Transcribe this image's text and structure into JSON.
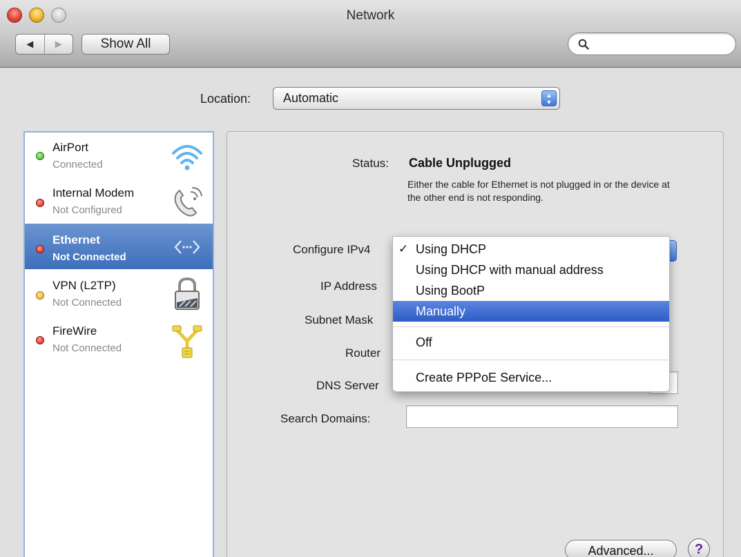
{
  "window": {
    "title": "Network"
  },
  "toolbar": {
    "back_glyph": "◀",
    "forward_glyph": "▶",
    "show_all_label": "Show All",
    "search_placeholder": ""
  },
  "location": {
    "label": "Location:",
    "value": "Automatic"
  },
  "services": [
    {
      "name": "AirPort",
      "status": "Connected",
      "state": "green",
      "icon": "wifi-icon"
    },
    {
      "name": "Internal Modem",
      "status": "Not Configured",
      "state": "red",
      "icon": "phone-icon"
    },
    {
      "name": "Ethernet",
      "status": "Not Connected",
      "state": "red",
      "icon": "ethernet-icon",
      "selected": true
    },
    {
      "name": "VPN (L2TP)",
      "status": "Not Connected",
      "state": "yellow",
      "icon": "lock-icon"
    },
    {
      "name": "FireWire",
      "status": "Not Connected",
      "state": "red",
      "icon": "firewire-icon"
    }
  ],
  "detail": {
    "status_label": "Status:",
    "status_value": "Cable Unplugged",
    "status_description": "Either the cable for Ethernet is not plugged in or the device at the other end is not responding.",
    "configure_label": "Configure IPv4",
    "ip_label": "IP Address",
    "subnet_label": "Subnet Mask",
    "router_label": "Router",
    "dns_label": "DNS Server",
    "search_domains_label": "Search Domains:",
    "advanced_label": "Advanced...",
    "help_label": "?"
  },
  "configure_menu": {
    "check_glyph": "✓",
    "items": [
      {
        "label": "Using DHCP",
        "checked": true
      },
      {
        "label": "Using DHCP with manual address"
      },
      {
        "label": "Using BootP"
      },
      {
        "label": "Manually",
        "highlighted": true
      },
      {
        "label": "Off"
      },
      {
        "label": "Create PPPoE Service..."
      }
    ]
  },
  "colors": {
    "selection_blue": "#3d6fbb",
    "status_green": "#34a31a",
    "status_red": "#d4140a",
    "status_yellow": "#e9a818"
  }
}
